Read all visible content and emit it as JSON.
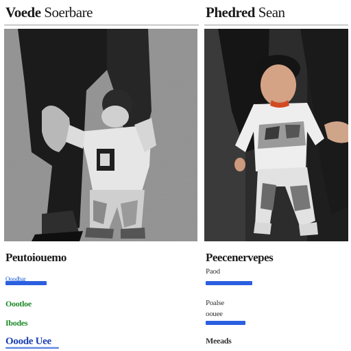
{
  "left": {
    "title_bold": "Voede",
    "title_light": "Soerbare",
    "info_title": "Peutoiouemo",
    "lines": [
      {
        "text": "Ooodbar",
        "color": "#1a5fd6"
      },
      {
        "text": "Oootloe",
        "color": "#1d8a2a"
      },
      {
        "text": "Ibodes",
        "color": "#1d8a2a"
      },
      {
        "text": "Ooode Uee",
        "color": "#1a3fb0"
      }
    ],
    "bar_color": "#2b5fe0"
  },
  "right": {
    "title_bold": "Phedred",
    "title_light": "Sean",
    "info_title": "Peecenervepes",
    "lines": [
      {
        "text": "Paod",
        "color": "#333333"
      },
      {
        "text": "Poalse",
        "color": "#333333"
      },
      {
        "text": "oouee",
        "color": "#333333"
      },
      {
        "text": "Meeads",
        "color": "#333333"
      }
    ],
    "bar_color": "#2b5fe0"
  },
  "colors": {
    "link_blue": "#2b5fe0",
    "link_green": "#1d8a2a",
    "text_dark": "#1a1a1a",
    "divider": "#9a9a9a"
  }
}
